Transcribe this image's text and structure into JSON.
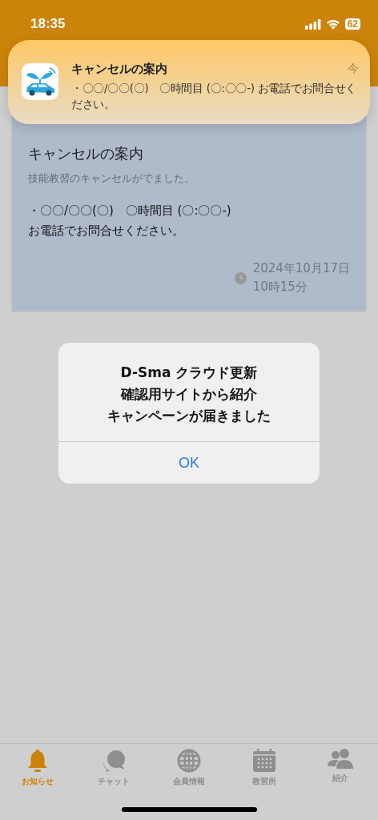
{
  "status_bar": {
    "time": "18:35",
    "battery": "62"
  },
  "notification": {
    "title": "キャンセルの案内",
    "time": "今",
    "body": "・〇〇/〇〇(〇)　〇時間目 (〇:〇〇-) お電話でお問合せください。"
  },
  "card": {
    "title": "キャンセルの案内",
    "subtitle": "技能教習のキャンセルがでました。",
    "body_lines": [
      "・〇〇/〇〇(〇)　〇時間目 (〇:〇〇-)",
      "お電話でお問合せください。"
    ],
    "date_lines": [
      "2024年10月17日",
      "10時15分"
    ]
  },
  "alert": {
    "message_lines": [
      "D-Sma クラウド更新",
      "確認用サイトから紹介",
      "キャンペーンが届きました"
    ],
    "button": "OK"
  },
  "tab_bar": [
    {
      "kind": "bell",
      "label": "お知らせ",
      "selected": true
    },
    {
      "kind": "chat",
      "label": "チャット",
      "selected": false
    },
    {
      "kind": "globe",
      "label": "会員情報",
      "selected": false
    },
    {
      "kind": "calendar",
      "label": "教習所",
      "selected": false
    },
    {
      "kind": "people",
      "label": "紹介",
      "selected": false
    }
  ]
}
